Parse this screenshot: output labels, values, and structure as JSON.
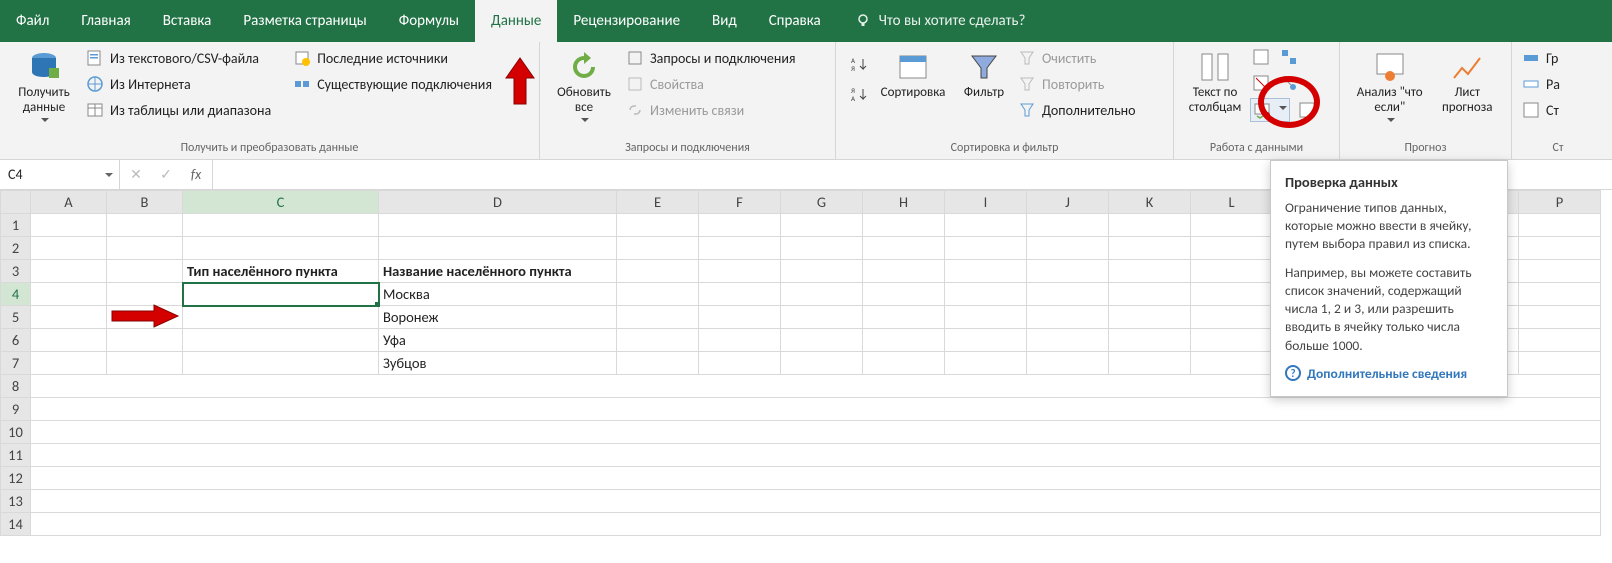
{
  "tabs": {
    "file": "Файл",
    "home": "Главная",
    "insert": "Вставка",
    "layout": "Разметка страницы",
    "formulas": "Формулы",
    "data": "Данные",
    "review": "Рецензирование",
    "view": "Вид",
    "help": "Справка",
    "tell_me": "Что вы хотите сделать?"
  },
  "ribbon": {
    "get_data": "Получить данные",
    "from_csv": "Из текстового/CSV-файла",
    "from_web": "Из Интернета",
    "from_table": "Из таблицы или диапазона",
    "recent_sources": "Последние источники",
    "existing_conn": "Существующие подключения",
    "group_get": "Получить и преобразовать данные",
    "refresh_all": "Обновить все",
    "queries": "Запросы и подключения",
    "properties": "Свойства",
    "edit_links": "Изменить связи",
    "group_queries": "Запросы и подключения",
    "sort_az": "А↓Я",
    "sort_za": "Я↓А",
    "sort": "Сортировка",
    "filter": "Фильтр",
    "clear": "Очистить",
    "reapply": "Повторить",
    "advanced": "Дополнительно",
    "group_sort": "Сортировка и фильтр",
    "text_to_cols": "Текст по столбцам",
    "group_tools": "Работа с данными",
    "whatif": "Анализ \"что если\"",
    "forecast": "Лист прогноза",
    "group_forecast": "Прогноз",
    "group_outline_g": "Гр",
    "group_outline_r": "Ра",
    "group_outline_s": "Ст"
  },
  "namebox": "C4",
  "fx": "fx",
  "columns": [
    "A",
    "B",
    "C",
    "D",
    "E",
    "F",
    "G",
    "H",
    "I",
    "J",
    "K",
    "L",
    "",
    "P"
  ],
  "rows": [
    "1",
    "2",
    "3",
    "4",
    "5",
    "6",
    "7",
    "8",
    "9",
    "10",
    "11",
    "12",
    "13",
    "14"
  ],
  "cells": {
    "C3": "Тип населённого пункта",
    "D3": "Название населённого пункта",
    "D4": "Москва",
    "D5": "Воронеж",
    "D6": "Уфа",
    "D7": "Зубцов"
  },
  "tooltip": {
    "title": "Проверка данных",
    "p1": "Ограничение типов данных, которые можно ввести в ячейку, путем выбора правил из списка.",
    "p2": "Например, вы можете составить список значений, содержащий числа 1, 2 и 3, или разрешить вводить в ячейку только числа больше 1000.",
    "link": "Дополнительные сведения"
  }
}
